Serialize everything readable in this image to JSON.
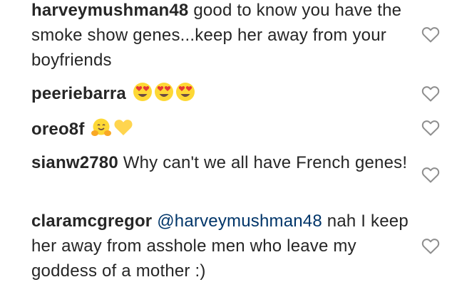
{
  "comments": [
    {
      "username": "harveymushman48",
      "mention": "",
      "text": "good to know you have the smoke show genes...keep her away from your boyfriends",
      "emojis": []
    },
    {
      "username": "peeriebarra",
      "mention": "",
      "text": "",
      "emojis": [
        "heart-eyes-face",
        "heart-eyes-face",
        "heart-eyes-face"
      ]
    },
    {
      "username": "oreo8f",
      "mention": "",
      "text": "",
      "emojis": [
        "hugging-face",
        "yellow-heart"
      ]
    },
    {
      "username": "sianw2780",
      "mention": "",
      "text": "Why can't we all have French genes!",
      "emojis": []
    },
    {
      "username": "claramcgregor",
      "mention": "@harveymushman48",
      "text": "nah I keep her away from asshole men who leave my goddess of a mother :)",
      "emojis": []
    }
  ],
  "like_icon": "heart-outline-icon",
  "colors": {
    "text": "#262626",
    "mention": "#003569",
    "icon": "#8e8e8e",
    "emoji_face": "#fdd835",
    "emoji_heart_red": "#e53935",
    "emoji_heart_yellow": "#ffd54f"
  }
}
